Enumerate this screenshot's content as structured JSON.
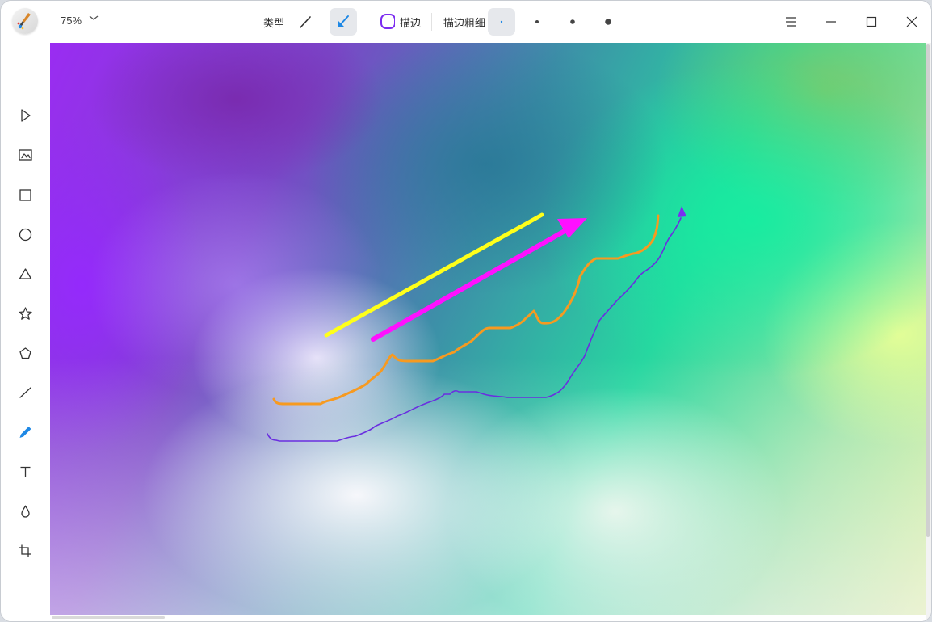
{
  "toolbar": {
    "zoom": "75%",
    "type_label": "类型",
    "outline_label": "描边",
    "stroke_width_label": "描边粗细",
    "icons": [
      "app-logo",
      "chevron-down-icon",
      "line-icon",
      "arrow-icon",
      "outline-circle-icon",
      "stroke-dot-icon",
      "menu-icon",
      "minimize-icon",
      "maximize-icon",
      "close-icon"
    ]
  },
  "sidebar": {
    "tools": [
      "select-icon",
      "image-icon",
      "rectangle-icon",
      "ellipse-icon",
      "triangle-icon",
      "star-icon",
      "polygon-icon",
      "line-icon",
      "pen-icon",
      "text-icon",
      "blur-icon",
      "crop-icon"
    ],
    "active_tool": "pen-icon"
  },
  "colors": {
    "accent": "#1e88e5",
    "outline_accent": "#7b2cf0",
    "yellow_line": "#ffff1a",
    "magenta_arrow": "#ff10ff",
    "orange_stroke": "#f79a20",
    "purple_stroke": "#6a2ee0"
  },
  "canvas": {
    "annotations": [
      "yellow-line",
      "magenta-arrow",
      "orange-freehand-stroke",
      "purple-freehand-arrow"
    ]
  }
}
